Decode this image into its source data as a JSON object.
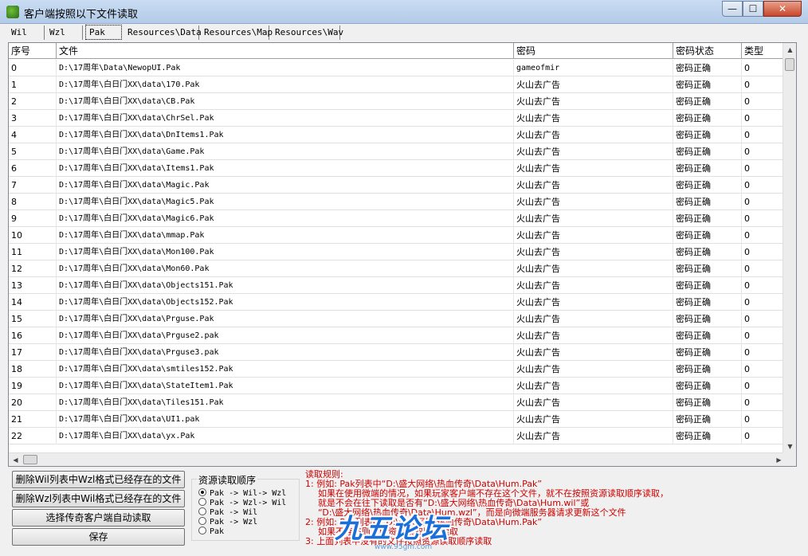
{
  "window": {
    "title": "客户端按照以下文件读取",
    "min": "—",
    "max": "☐",
    "close": "✕"
  },
  "tabs": [
    "Wil",
    "Wzl",
    "Pak",
    "Resources\\Data",
    "Resources\\Map",
    "Resources\\Wav"
  ],
  "table": {
    "headers": [
      "序号",
      "文件",
      "密码",
      "密码状态",
      "类型"
    ],
    "rows": [
      [
        "0",
        "D:\\17周年\\Data\\NewopUI.Pak",
        "gameofmir",
        "密码正确",
        "0"
      ],
      [
        "1",
        "D:\\17周年\\白日门XX\\data\\170.Pak",
        "火山去广告",
        "密码正确",
        "0"
      ],
      [
        "2",
        "D:\\17周年\\白日门XX\\data\\CB.Pak",
        "火山去广告",
        "密码正确",
        "0"
      ],
      [
        "3",
        "D:\\17周年\\白日门XX\\data\\ChrSel.Pak",
        "火山去广告",
        "密码正确",
        "0"
      ],
      [
        "4",
        "D:\\17周年\\白日门XX\\data\\DnItems1.Pak",
        "火山去广告",
        "密码正确",
        "0"
      ],
      [
        "5",
        "D:\\17周年\\白日门XX\\data\\Game.Pak",
        "火山去广告",
        "密码正确",
        "0"
      ],
      [
        "6",
        "D:\\17周年\\白日门XX\\data\\Items1.Pak",
        "火山去广告",
        "密码正确",
        "0"
      ],
      [
        "7",
        "D:\\17周年\\白日门XX\\data\\Magic.Pak",
        "火山去广告",
        "密码正确",
        "0"
      ],
      [
        "8",
        "D:\\17周年\\白日门XX\\data\\Magic5.Pak",
        "火山去广告",
        "密码正确",
        "0"
      ],
      [
        "9",
        "D:\\17周年\\白日门XX\\data\\Magic6.Pak",
        "火山去广告",
        "密码正确",
        "0"
      ],
      [
        "10",
        "D:\\17周年\\白日门XX\\data\\mmap.Pak",
        "火山去广告",
        "密码正确",
        "0"
      ],
      [
        "11",
        "D:\\17周年\\白日门XX\\data\\Mon100.Pak",
        "火山去广告",
        "密码正确",
        "0"
      ],
      [
        "12",
        "D:\\17周年\\白日门XX\\data\\Mon60.Pak",
        "火山去广告",
        "密码正确",
        "0"
      ],
      [
        "13",
        "D:\\17周年\\白日门XX\\data\\Objects151.Pak",
        "火山去广告",
        "密码正确",
        "0"
      ],
      [
        "14",
        "D:\\17周年\\白日门XX\\data\\Objects152.Pak",
        "火山去广告",
        "密码正确",
        "0"
      ],
      [
        "15",
        "D:\\17周年\\白日门XX\\data\\Prguse.Pak",
        "火山去广告",
        "密码正确",
        "0"
      ],
      [
        "16",
        "D:\\17周年\\白日门XX\\data\\Prguse2.pak",
        "火山去广告",
        "密码正确",
        "0"
      ],
      [
        "17",
        "D:\\17周年\\白日门XX\\data\\Prguse3.pak",
        "火山去广告",
        "密码正确",
        "0"
      ],
      [
        "18",
        "D:\\17周年\\白日门XX\\data\\smtiles152.Pak",
        "火山去广告",
        "密码正确",
        "0"
      ],
      [
        "19",
        "D:\\17周年\\白日门XX\\data\\StateItem1.Pak",
        "火山去广告",
        "密码正确",
        "0"
      ],
      [
        "20",
        "D:\\17周年\\白日门XX\\data\\Tiles151.Pak",
        "火山去广告",
        "密码正确",
        "0"
      ],
      [
        "21",
        "D:\\17周年\\白日门XX\\data\\UI1.pak",
        "火山去广告",
        "密码正确",
        "0"
      ],
      [
        "22",
        "D:\\17周年\\白日门XX\\data\\yx.Pak",
        "火山去广告",
        "密码正确",
        "0"
      ]
    ]
  },
  "buttons": {
    "delete_wil": "删除Wil列表中Wzl格式已经存在的文件",
    "delete_wzl": "删除Wzl列表中Wil格式已经存在的文件",
    "select_client": "选择传奇客户端自动读取",
    "save": "保存"
  },
  "resource_order": {
    "title": "资源读取顺序",
    "options": [
      "Pak -> Wil-> Wzl",
      "Pak -> Wzl-> Wil",
      "Pak -> Wil",
      "Pak -> Wzl",
      "Pak"
    ],
    "selected_index": 0
  },
  "rules": {
    "heading": "读取规则:",
    "lines": [
      "1: 例如: Pak列表中“D:\\盛大网络\\热血传奇\\Data\\Hum.Pak”",
      "如果在使用微端的情况，如果玩家客户端不存在这个文件，就不在按照资源读取顺序读取，",
      "就是不会在往下读取是否有“D:\\盛大网络\\热血传奇\\Data\\Hum.wil”或",
      "“D:\\盛大网络\\热血传奇\\Data\\Hum.wzl”，而是向微端服务器请求更新这个文件",
      "2: 例如: Pak列表中“D:\\盛大网络\\热血传奇\\Data\\Hum.Pak”",
      "如果不存在则按照资源读取顺序读取",
      "3: 上面列表中没有的文件按照资源读取顺序读取"
    ]
  },
  "watermark": {
    "logo": "九五论坛",
    "url": "www.95gm.com"
  }
}
